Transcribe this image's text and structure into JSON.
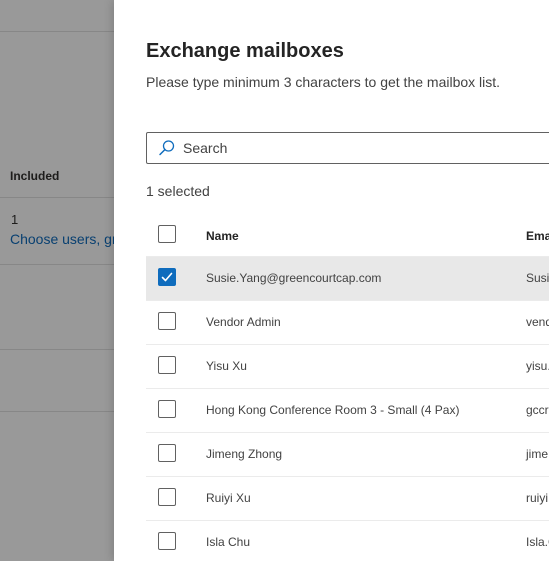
{
  "background": {
    "column_header": "Included",
    "count": "1",
    "link_text": "Choose users, gr"
  },
  "panel": {
    "title": "Exchange mailboxes",
    "subtitle": "Please type minimum 3 characters to get the mailbox list.",
    "search": {
      "placeholder": "Search",
      "value": "",
      "icon": "search-icon"
    },
    "selected_count": "1 selected",
    "columns": {
      "name": "Name",
      "email": "Ema"
    },
    "rows": [
      {
        "name": "Susie.Yang@greencourtcap.com",
        "email": "Susie",
        "checked": true
      },
      {
        "name": "Vendor Admin",
        "email": "vendo",
        "checked": false
      },
      {
        "name": "Yisu Xu",
        "email": "yisu.",
        "checked": false
      },
      {
        "name": "Hong Kong Conference Room 3 - Small (4 Pax)",
        "email": "gccr",
        "checked": false
      },
      {
        "name": "Jimeng Zhong",
        "email": "jime",
        "checked": false
      },
      {
        "name": "Ruiyi Xu",
        "email": "ruiyi",
        "checked": false
      },
      {
        "name": "Isla Chu",
        "email": "Isla.C",
        "checked": false
      }
    ]
  },
  "colors": {
    "accent": "#0f6cbd",
    "selected_row": "#e8e8e8",
    "overlay": "rgba(0,0,0,0.40)"
  }
}
